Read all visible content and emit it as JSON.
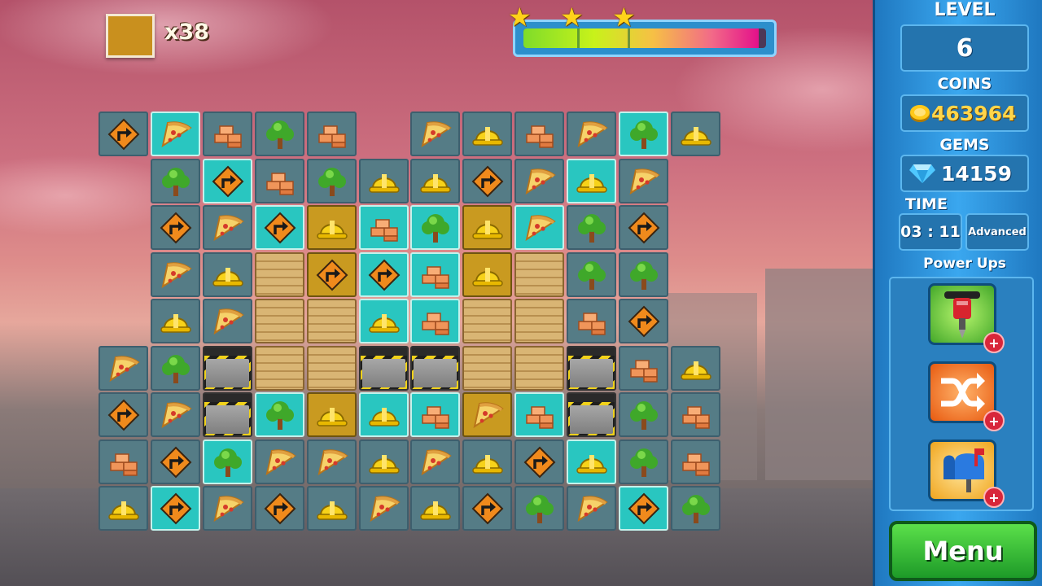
{
  "goal": {
    "count_text": "x38",
    "color": "#c9901e"
  },
  "progress": {
    "value": 0.97,
    "stars_earned": 3,
    "star_glyph": "★"
  },
  "board": {
    "rows": [
      [
        {
          "t": "sign",
          "bg": "n"
        },
        {
          "t": "pizza",
          "bg": "teal"
        },
        {
          "t": "bricks",
          "bg": "n"
        },
        {
          "t": "tree",
          "bg": "n"
        },
        {
          "t": "bricks",
          "bg": "n"
        },
        null,
        {
          "t": "pizza",
          "bg": "n"
        },
        {
          "t": "helmet",
          "bg": "n"
        },
        {
          "t": "bricks",
          "bg": "n"
        },
        {
          "t": "pizza",
          "bg": "n"
        },
        {
          "t": "tree",
          "bg": "teal"
        },
        {
          "t": "helmet",
          "bg": "n"
        }
      ],
      [
        null,
        {
          "t": "tree",
          "bg": "n"
        },
        {
          "t": "sign",
          "bg": "teal"
        },
        {
          "t": "bricks",
          "bg": "n"
        },
        {
          "t": "tree",
          "bg": "n"
        },
        {
          "t": "helmet",
          "bg": "n"
        },
        {
          "t": "helmet",
          "bg": "n"
        },
        {
          "t": "sign",
          "bg": "n"
        },
        {
          "t": "pizza",
          "bg": "n"
        },
        {
          "t": "helmet",
          "bg": "teal"
        },
        {
          "t": "pizza",
          "bg": "n"
        },
        null
      ],
      [
        null,
        {
          "t": "sign",
          "bg": "n"
        },
        {
          "t": "pizza",
          "bg": "n"
        },
        {
          "t": "sign",
          "bg": "teal"
        },
        {
          "t": "helmet",
          "bg": "gold"
        },
        {
          "t": "bricks",
          "bg": "teal"
        },
        {
          "t": "tree",
          "bg": "teal"
        },
        {
          "t": "helmet",
          "bg": "gold"
        },
        {
          "t": "pizza",
          "bg": "teal"
        },
        {
          "t": "tree",
          "bg": "n"
        },
        {
          "t": "sign",
          "bg": "n"
        },
        null
      ],
      [
        null,
        {
          "t": "pizza",
          "bg": "n"
        },
        {
          "t": "helmet",
          "bg": "n"
        },
        {
          "t": "",
          "bg": "wood"
        },
        {
          "t": "sign",
          "bg": "gold"
        },
        {
          "t": "sign",
          "bg": "teal"
        },
        {
          "t": "bricks",
          "bg": "teal"
        },
        {
          "t": "helmet",
          "bg": "gold"
        },
        {
          "t": "",
          "bg": "wood"
        },
        {
          "t": "tree",
          "bg": "n"
        },
        {
          "t": "tree",
          "bg": "n"
        },
        null
      ],
      [
        null,
        {
          "t": "helmet",
          "bg": "n"
        },
        {
          "t": "pizza",
          "bg": "n"
        },
        {
          "t": "",
          "bg": "wood"
        },
        {
          "t": "",
          "bg": "wood"
        },
        {
          "t": "helmet",
          "bg": "teal"
        },
        {
          "t": "bricks",
          "bg": "teal"
        },
        {
          "t": "",
          "bg": "wood"
        },
        {
          "t": "",
          "bg": "wood"
        },
        {
          "t": "bricks",
          "bg": "n"
        },
        {
          "t": "sign",
          "bg": "n"
        },
        null
      ],
      [
        {
          "t": "pizza",
          "bg": "n"
        },
        {
          "t": "tree",
          "bg": "n"
        },
        {
          "t": "",
          "bg": "metal"
        },
        {
          "t": "",
          "bg": "wood"
        },
        {
          "t": "",
          "bg": "wood"
        },
        {
          "t": "",
          "bg": "metal"
        },
        {
          "t": "",
          "bg": "metal"
        },
        {
          "t": "",
          "bg": "wood"
        },
        {
          "t": "",
          "bg": "wood"
        },
        {
          "t": "",
          "bg": "metal"
        },
        {
          "t": "bricks",
          "bg": "n"
        },
        {
          "t": "helmet",
          "bg": "n"
        }
      ],
      [
        {
          "t": "sign",
          "bg": "n"
        },
        {
          "t": "pizza",
          "bg": "n"
        },
        {
          "t": "",
          "bg": "metal"
        },
        {
          "t": "tree",
          "bg": "teal"
        },
        {
          "t": "helmet",
          "bg": "gold"
        },
        {
          "t": "helmet",
          "bg": "teal"
        },
        {
          "t": "bricks",
          "bg": "teal"
        },
        {
          "t": "pizza",
          "bg": "gold"
        },
        {
          "t": "bricks",
          "bg": "teal"
        },
        {
          "t": "",
          "bg": "metal"
        },
        {
          "t": "tree",
          "bg": "n"
        },
        {
          "t": "bricks",
          "bg": "n"
        }
      ],
      [
        {
          "t": "bricks",
          "bg": "n"
        },
        {
          "t": "sign",
          "bg": "n"
        },
        {
          "t": "tree",
          "bg": "teal"
        },
        {
          "t": "pizza",
          "bg": "n"
        },
        {
          "t": "pizza",
          "bg": "n"
        },
        {
          "t": "helmet",
          "bg": "n"
        },
        {
          "t": "pizza",
          "bg": "n"
        },
        {
          "t": "helmet",
          "bg": "n"
        },
        {
          "t": "sign",
          "bg": "n"
        },
        {
          "t": "helmet",
          "bg": "teal"
        },
        {
          "t": "tree",
          "bg": "n"
        },
        {
          "t": "bricks",
          "bg": "n"
        }
      ],
      [
        {
          "t": "helmet",
          "bg": "n"
        },
        {
          "t": "sign",
          "bg": "teal"
        },
        {
          "t": "pizza",
          "bg": "n"
        },
        {
          "t": "sign",
          "bg": "n"
        },
        {
          "t": "helmet",
          "bg": "n"
        },
        {
          "t": "pizza",
          "bg": "n"
        },
        {
          "t": "helmet",
          "bg": "n"
        },
        {
          "t": "sign",
          "bg": "n"
        },
        {
          "t": "tree",
          "bg": "n"
        },
        {
          "t": "pizza",
          "bg": "n"
        },
        {
          "t": "sign",
          "bg": "teal"
        },
        {
          "t": "tree",
          "bg": "n"
        }
      ]
    ]
  },
  "panel": {
    "level_label": "LEVEL",
    "level_value": "6",
    "coins_label": "COINS",
    "coins_value": "463964",
    "gems_label": "GEMS",
    "gems_value": "14159",
    "time_label": "TIME",
    "time_value": "03 : 11",
    "difficulty": "Advanced",
    "powerups_label": "Power Ups",
    "powerups": [
      {
        "name": "jackhammer-icon",
        "plus": "+"
      },
      {
        "name": "shuffle-icon",
        "plus": "+"
      },
      {
        "name": "mailbox-icon",
        "plus": "+"
      }
    ],
    "menu_label": "Menu"
  }
}
